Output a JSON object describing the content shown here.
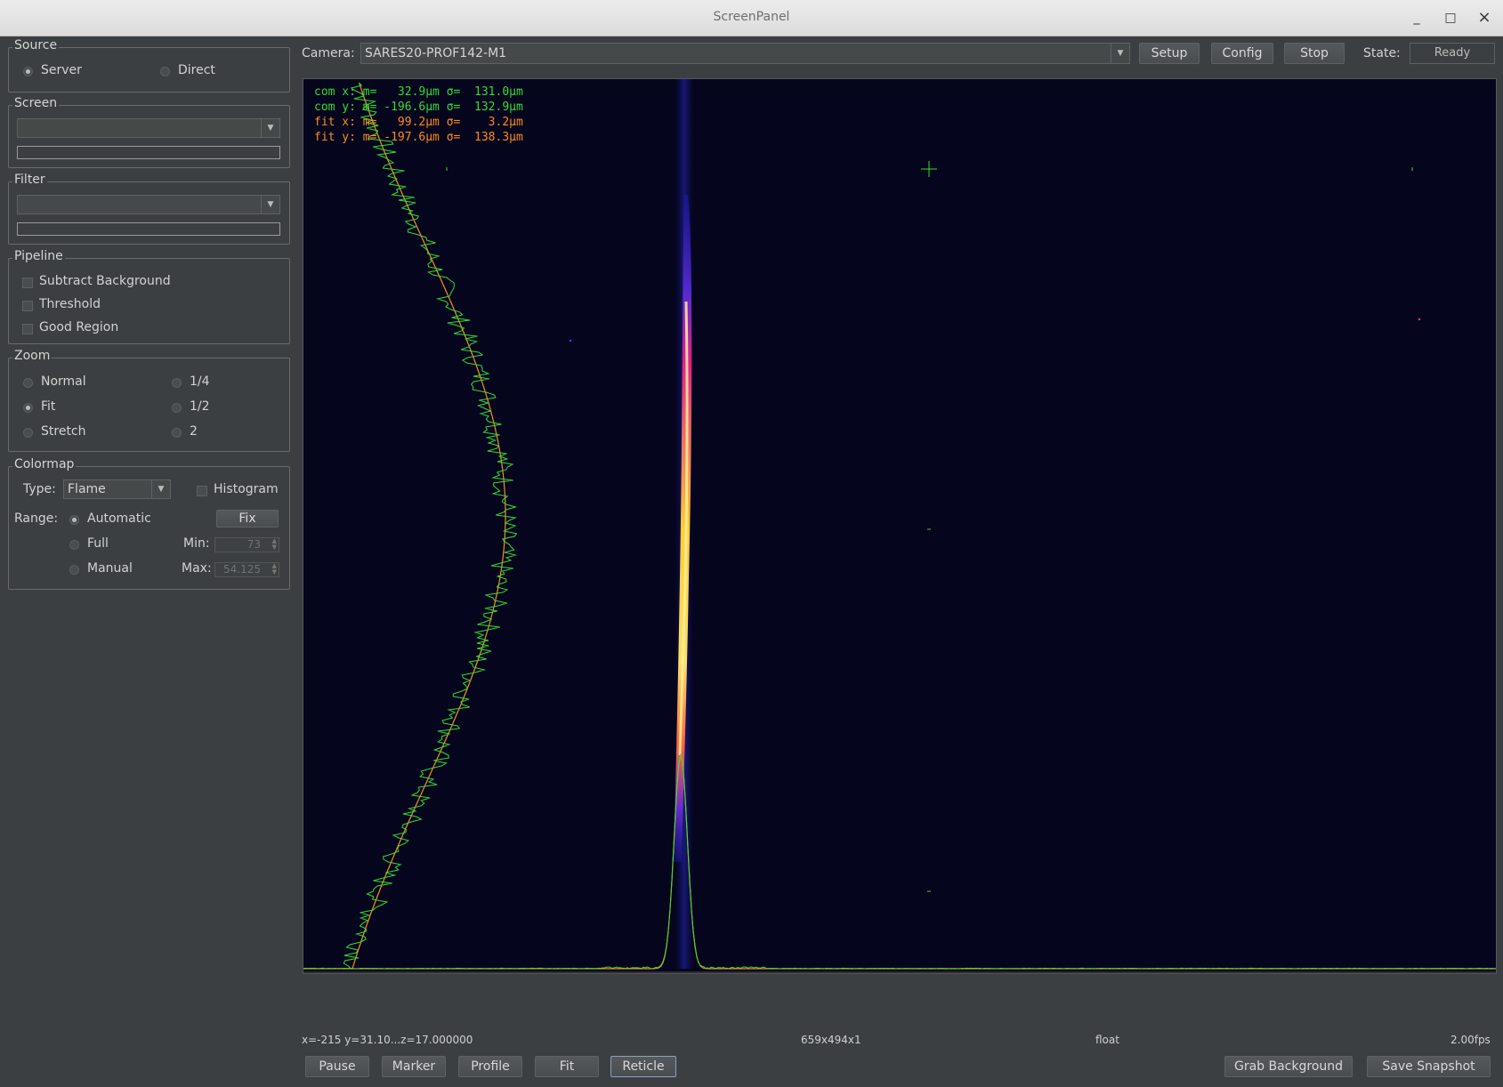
{
  "window": {
    "title": "ScreenPanel",
    "minimize": "_",
    "maximize": "□",
    "close": "×"
  },
  "source": {
    "title": "Source",
    "server": "Server",
    "direct": "Direct",
    "selected": "server"
  },
  "screen": {
    "title": "Screen",
    "value": ""
  },
  "filter": {
    "title": "Filter",
    "value": ""
  },
  "pipeline": {
    "title": "Pipeline",
    "subtract_background": "Subtract Background",
    "threshold": "Threshold",
    "good_region": "Good Region"
  },
  "zoom": {
    "title": "Zoom",
    "normal": "Normal",
    "fit": "Fit",
    "stretch": "Stretch",
    "quarter": "1/4",
    "half": "1/2",
    "two": "2",
    "selected": "fit"
  },
  "colormap": {
    "title": "Colormap",
    "type_label": "Type:",
    "type_value": "Flame",
    "histogram": "Histogram",
    "range_label": "Range:",
    "automatic": "Automatic",
    "full": "Full",
    "manual": "Manual",
    "fix_label": "Fix",
    "min_label": "Min:",
    "min_value": "73",
    "max_label": "Max:",
    "max_value": "54.125",
    "selected": "automatic"
  },
  "toolbar": {
    "camera_label": "Camera:",
    "camera_value": "SARES20-PROF142-M1",
    "setup": "Setup",
    "config": "Config",
    "stop": "Stop",
    "state_label": "State:",
    "state_value": "Ready"
  },
  "overlay": {
    "com_x": "com x: m=   32.9μm σ=  131.0μm",
    "com_y": "com y: m= -196.6μm σ=  132.9μm",
    "fit_x": "fit x: m=   99.2μm σ=    3.2μm",
    "fit_y": "fit y: m= -197.6μm σ=  138.3μm"
  },
  "status": {
    "coords": "x=-215    y=31.10...z=17.000000",
    "size": "659x494x1",
    "type": "float",
    "fps": "2.00fps"
  },
  "bottom": {
    "pause": "Pause",
    "marker": "Marker",
    "profile": "Profile",
    "fit": "Fit",
    "reticle": "Reticle",
    "grab_background": "Grab Background",
    "save_snapshot": "Save Snapshot"
  },
  "colors": {
    "overlay_green": "#33dd33",
    "overlay_orange": "#ff8c1a",
    "image_bg": "#05051e"
  }
}
